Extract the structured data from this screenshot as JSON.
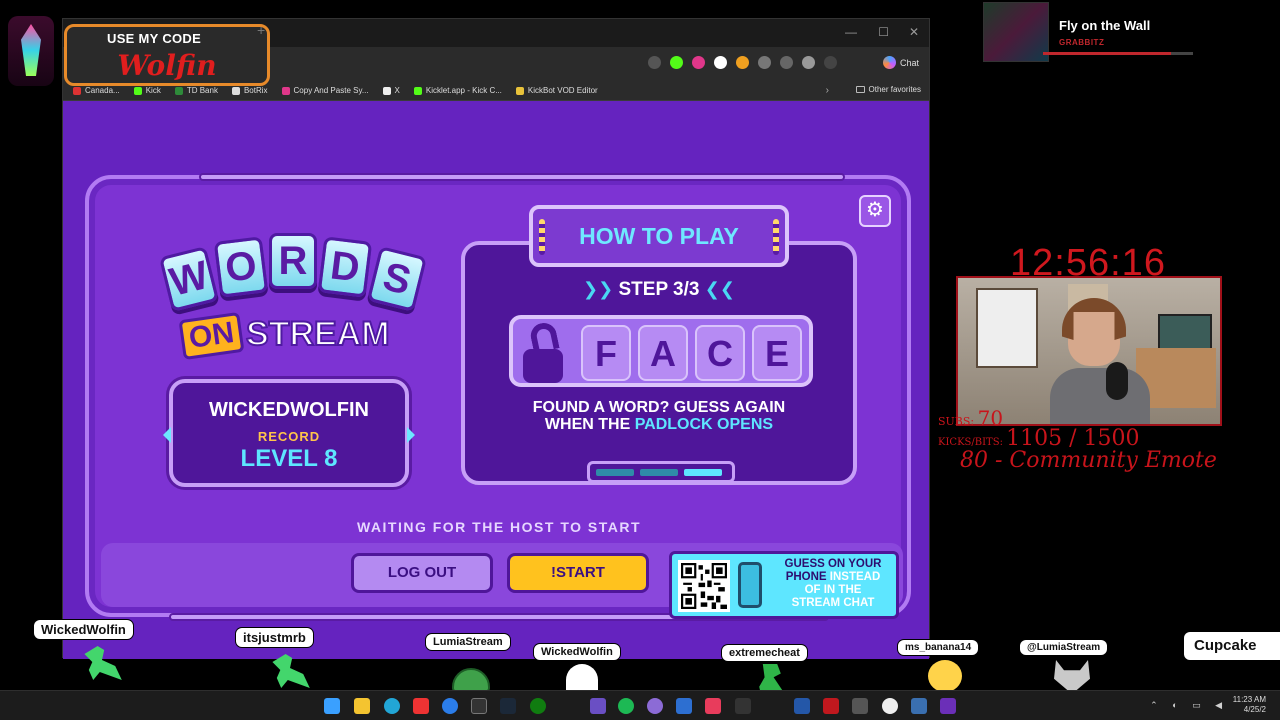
{
  "code_badge": {
    "label": "USE MY CODE",
    "value": "Wolfin"
  },
  "browser": {
    "chat_label": "Chat",
    "bookmarks": [
      {
        "label": "Canada...",
        "color": "#d33"
      },
      {
        "label": "Kick",
        "color": "#53fc18"
      },
      {
        "label": "TD Bank",
        "color": "#2e8b3a"
      },
      {
        "label": "BotRix",
        "color": "#ddd"
      },
      {
        "label": "Copy And Paste Sy...",
        "color": "#e0378a"
      },
      {
        "label": "X",
        "color": "#eee"
      },
      {
        "label": "Kicklet.app - Kick C...",
        "color": "#53fc18"
      },
      {
        "label": "KickBot VOD Editor",
        "color": "#e8c23a"
      }
    ],
    "other_favorites": "Other favorites"
  },
  "game": {
    "logo_letters": [
      "W",
      "O",
      "R",
      "D",
      "S"
    ],
    "logo_on": "ON",
    "logo_stream": "STREAM",
    "player": {
      "name": "WICKEDWOLFIN",
      "record_label": "RECORD",
      "level": "LEVEL 8"
    },
    "how_to_play": {
      "title": "HOW TO PLAY",
      "step_prefix": "❯❯",
      "step": "STEP 3/3",
      "step_suffix": "❮❮",
      "word": [
        "F",
        "A",
        "C",
        "E"
      ],
      "hint_line1": "FOUND A WORD? GUESS AGAIN",
      "hint_line2_prefix": "WHEN THE ",
      "hint_line2_highlight": "PADLOCK OPENS",
      "progress_total": 3,
      "progress_current": 3
    },
    "status": "WAITING FOR THE HOST TO START",
    "logout_label": "LOG OUT",
    "start_label": "!START",
    "qr_text": {
      "line1": "GUESS ON YOUR",
      "line2a": "PHONE ",
      "line2b": "INSTEAD",
      "line3": "OF IN THE",
      "line4": "STREAM CHAT"
    }
  },
  "now_playing": {
    "title": "Fly on the Wall",
    "artist": "GRABBITZ",
    "progress": 0.85
  },
  "stream_overlay": {
    "clock": "12:56:16",
    "subs_label": "SUBS:",
    "subs_value": "70",
    "kicks_label": "KICKS/BITS:",
    "kicks_value": "1105 / 1500",
    "goal_text": "80 - Community Emote"
  },
  "chatters": [
    {
      "name": "WickedWolfin",
      "creature": "lizard"
    },
    {
      "name": "itsjustmrb",
      "creature": "lizard"
    },
    {
      "name": "LumiaStream",
      "creature": "turtle"
    },
    {
      "name": "WickedWolfin",
      "creature": "ghost"
    },
    {
      "name": "extremecheat",
      "creature": "dino"
    },
    {
      "name": "ms_banana14",
      "creature": "chick"
    },
    {
      "name": "@LumiaStream",
      "creature": "wolf"
    },
    {
      "name": "Cupcake",
      "creature": ""
    }
  ],
  "taskbar": {
    "time": "11:23 AM",
    "date": "4/25/2"
  }
}
